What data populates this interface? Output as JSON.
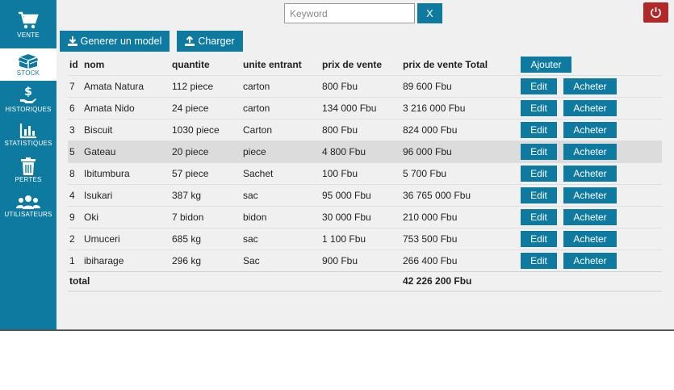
{
  "sidebar": {
    "items": [
      {
        "label": "VENTE",
        "icon": "cart-icon"
      },
      {
        "label": "STOCK",
        "icon": "box-icon"
      },
      {
        "label": "HISTORIQUES",
        "icon": "money-hand-icon"
      },
      {
        "label": "STATISTIQUES",
        "icon": "bar-chart-icon"
      },
      {
        "label": "PERTES",
        "icon": "trash-icon"
      },
      {
        "label": "UTILISATEURS",
        "icon": "users-icon"
      }
    ]
  },
  "search": {
    "placeholder": "Keyword",
    "value": "",
    "button_label": "X"
  },
  "toolbar": {
    "generate_label": "Generer un model",
    "charger_label": "Charger"
  },
  "colors": {
    "accent": "#0e7aa0",
    "power": "#b02828",
    "highlight_row": "#dcdcdc"
  },
  "table": {
    "headers": {
      "id": "id",
      "nom": "nom",
      "quantite": "quantite",
      "unite": "unite entrant",
      "prix": "prix de vente",
      "total": "prix de vente Total",
      "add": "Ajouter"
    },
    "rows": [
      {
        "id": "7",
        "nom": "Amata Natura",
        "quantite": "112 piece",
        "unite": "carton",
        "prix": "800 Fbu",
        "total": "89 600 Fbu"
      },
      {
        "id": "6",
        "nom": "Amata Nido",
        "quantite": "24 piece",
        "unite": "carton",
        "prix": "134 000 Fbu",
        "total": "3 216 000 Fbu"
      },
      {
        "id": "3",
        "nom": "Biscuit",
        "quantite": "1030 piece",
        "unite": "Carton",
        "prix": "800 Fbu",
        "total": "824 000 Fbu"
      },
      {
        "id": "5",
        "nom": "Gateau",
        "quantite": "20 piece",
        "unite": "piece",
        "prix": "4 800 Fbu",
        "total": "96 000 Fbu"
      },
      {
        "id": "8",
        "nom": "Ibitumbura",
        "quantite": "57 piece",
        "unite": "Sachet",
        "prix": "100 Fbu",
        "total": "5 700 Fbu"
      },
      {
        "id": "4",
        "nom": "Isukari",
        "quantite": "387 kg",
        "unite": "sac",
        "prix": "95 000 Fbu",
        "total": "36 765 000 Fbu"
      },
      {
        "id": "9",
        "nom": "Oki",
        "quantite": "7 bidon",
        "unite": "bidon",
        "prix": "30 000 Fbu",
        "total": "210 000 Fbu"
      },
      {
        "id": "2",
        "nom": "Umuceri",
        "quantite": "685 kg",
        "unite": "sac",
        "prix": "1 100 Fbu",
        "total": "753 500 Fbu"
      },
      {
        "id": "1",
        "nom": "ibiharage",
        "quantite": "296 kg",
        "unite": "Sac",
        "prix": "900 Fbu",
        "total": "266 400 Fbu"
      }
    ],
    "edit_label": "Edit",
    "buy_label": "Acheter",
    "footer": {
      "label": "total",
      "total": "42 226 200 Fbu"
    }
  }
}
